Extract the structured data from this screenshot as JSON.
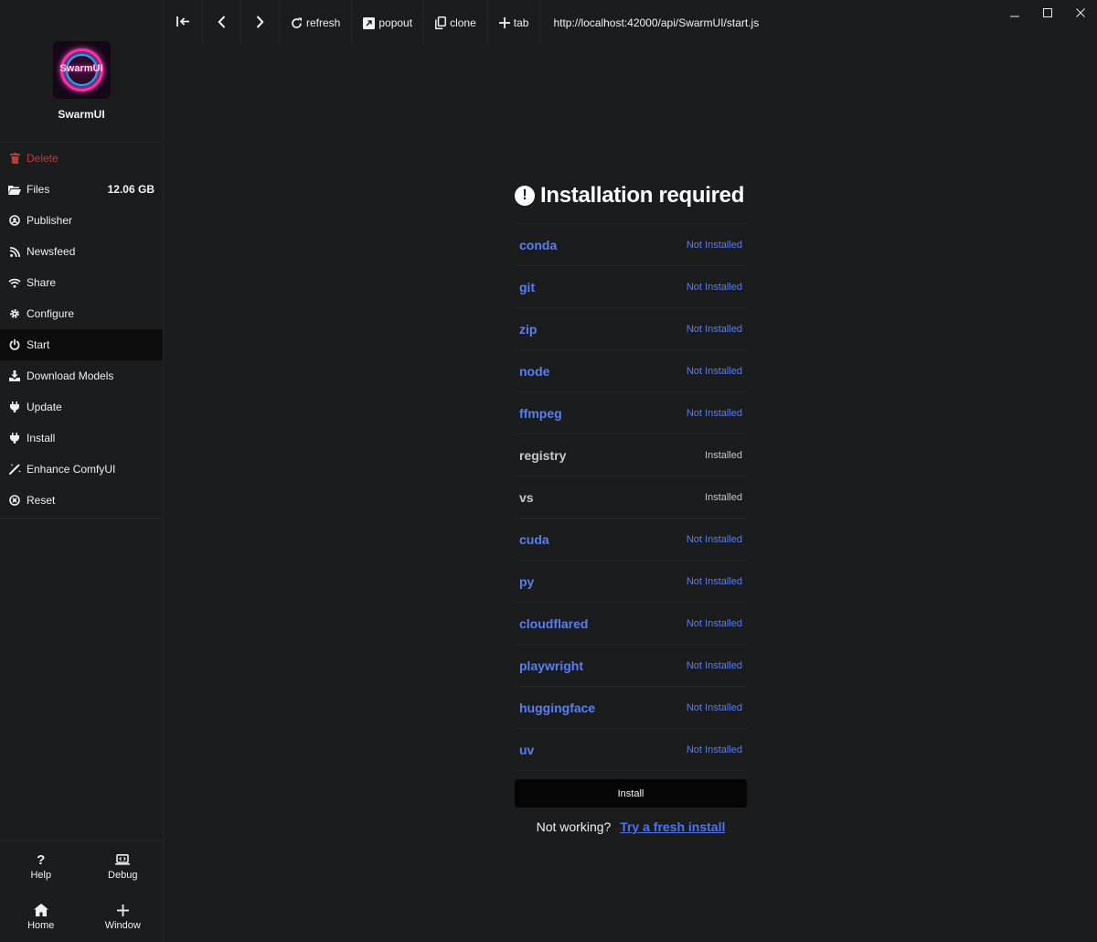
{
  "app": {
    "name": "SwarmUI",
    "logo_text": "SwarmUI"
  },
  "sidebar": {
    "items": [
      {
        "label": "Delete",
        "icon": "trash-icon"
      },
      {
        "label": "Files",
        "icon": "folder-open-icon",
        "value": "12.06 GB"
      },
      {
        "label": "Publisher",
        "icon": "user-circle-icon"
      },
      {
        "label": "Newsfeed",
        "icon": "rss-icon"
      },
      {
        "label": "Share",
        "icon": "wifi-icon"
      },
      {
        "label": "Configure",
        "icon": "gear-icon"
      },
      {
        "label": "Start",
        "icon": "power-icon"
      },
      {
        "label": "Download Models",
        "icon": "download-icon"
      },
      {
        "label": "Update",
        "icon": "plug-icon"
      },
      {
        "label": "Install",
        "icon": "plug-icon"
      },
      {
        "label": "Enhance ComfyUI",
        "icon": "magic-wand-icon"
      },
      {
        "label": "Reset",
        "icon": "circle-x-icon"
      }
    ],
    "active": "Start",
    "bottom": {
      "help": "Help",
      "debug": "Debug",
      "home": "Home",
      "window": "Window"
    }
  },
  "toolbar": {
    "refresh": "refresh",
    "popout": "popout",
    "clone": "clone",
    "tab": "tab",
    "url": "http://localhost:42000/api/SwarmUI/start.js"
  },
  "main": {
    "title": "Installation required",
    "requirements": [
      {
        "name": "conda",
        "status": "Not Installed"
      },
      {
        "name": "git",
        "status": "Not Installed"
      },
      {
        "name": "zip",
        "status": "Not Installed"
      },
      {
        "name": "node",
        "status": "Not Installed"
      },
      {
        "name": "ffmpeg",
        "status": "Not Installed"
      },
      {
        "name": "registry",
        "status": "Installed"
      },
      {
        "name": "vs",
        "status": "Installed"
      },
      {
        "name": "cuda",
        "status": "Not Installed"
      },
      {
        "name": "py",
        "status": "Not Installed"
      },
      {
        "name": "cloudflared",
        "status": "Not Installed"
      },
      {
        "name": "playwright",
        "status": "Not Installed"
      },
      {
        "name": "huggingface",
        "status": "Not Installed"
      },
      {
        "name": "uv",
        "status": "Not Installed"
      }
    ],
    "install_label": "Install",
    "help_text": "Not working?",
    "help_link": "Try a fresh install"
  },
  "colors": {
    "accent": "#5b7ff0",
    "link": "#4b74f5",
    "danger": "#c0393b",
    "background": "#1b1c1e"
  }
}
